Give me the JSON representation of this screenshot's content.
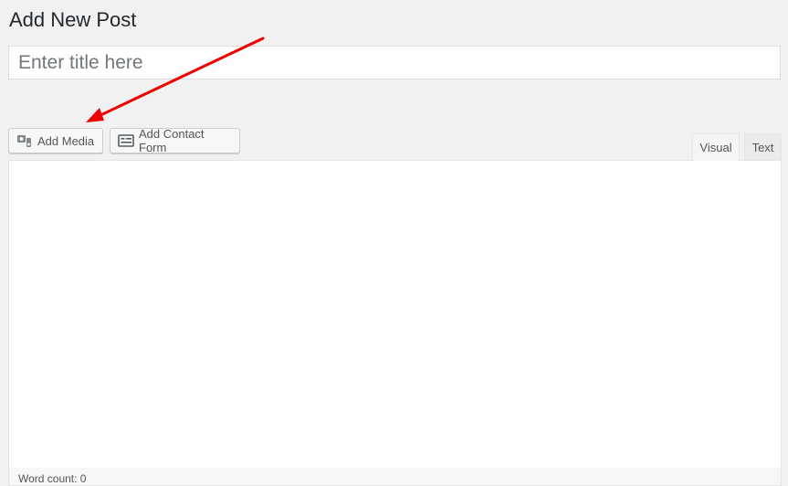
{
  "page": {
    "title": "Add New Post"
  },
  "title_field": {
    "placeholder": "Enter title here",
    "value": ""
  },
  "toolbar": {
    "add_media_label": "Add Media",
    "add_contact_form_label": "Add Contact Form"
  },
  "editor": {
    "tabs": [
      {
        "label": "Visual",
        "active": true
      },
      {
        "label": "Text",
        "active": false
      }
    ],
    "content": ""
  },
  "status": {
    "word_count_label": "Word count: 0"
  },
  "colors": {
    "annotation_arrow": "#ee0000",
    "background": "#f1f1f1"
  }
}
